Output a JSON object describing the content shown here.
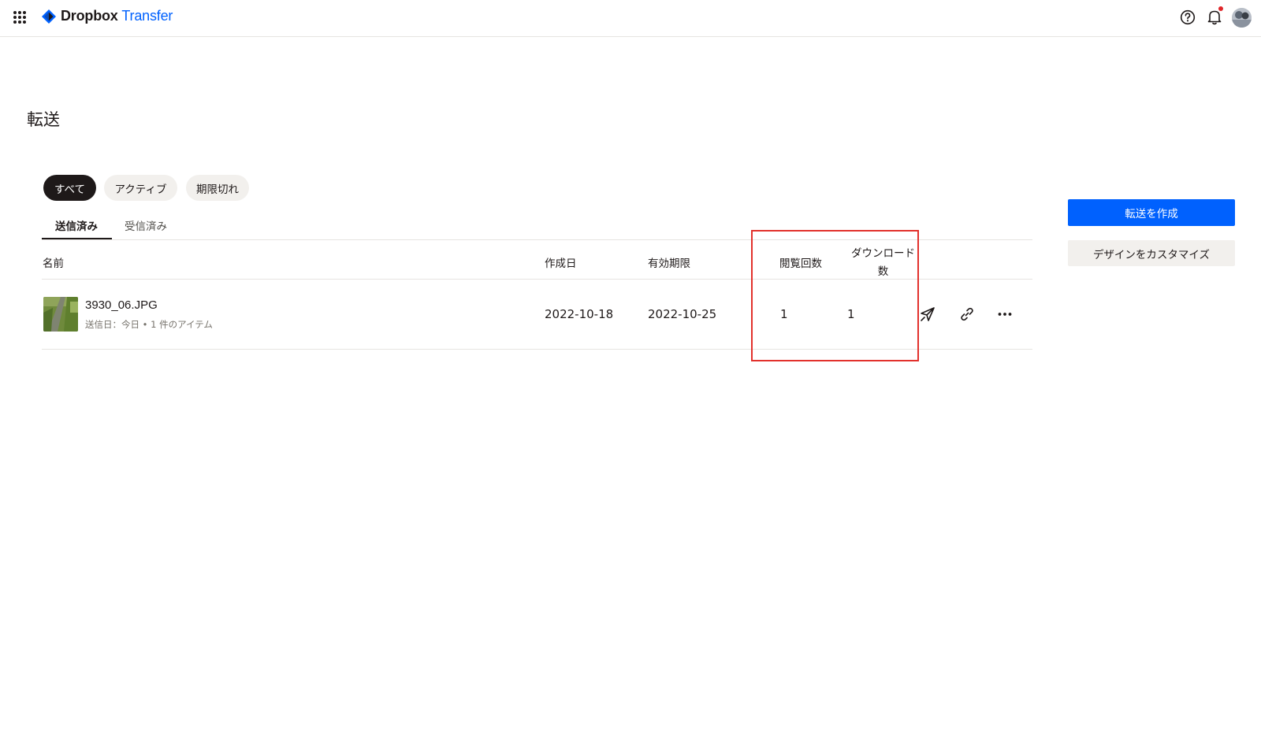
{
  "header": {
    "brand_name": "Dropbox",
    "product_name": "Transfer",
    "accent_color": "#0061fe",
    "icons": [
      "apps-grid-icon",
      "dropbox-logo-icon",
      "help-icon",
      "bell-icon",
      "avatar"
    ]
  },
  "page": {
    "title": "転送"
  },
  "filters": {
    "chips": [
      {
        "label": "すべて",
        "selected": true
      },
      {
        "label": "アクティブ",
        "selected": false
      },
      {
        "label": "期限切れ",
        "selected": false
      }
    ]
  },
  "tabs": [
    {
      "label": "送信済み",
      "selected": true
    },
    {
      "label": "受信済み",
      "selected": false
    }
  ],
  "table": {
    "columns": {
      "name": "名前",
      "created": "作成日",
      "expires": "有効期限",
      "views": "閲覧回数",
      "downloads_line1": "ダウンロード",
      "downloads_line2": "数"
    },
    "rows": [
      {
        "name": "3930_06.JPG",
        "meta": "送信日：今日 • 1 件のアイテム",
        "created": "2022-10-18",
        "expires": "2022-10-25",
        "views": "1",
        "downloads": "1",
        "actions": [
          "send-icon",
          "link-icon",
          "more-icon"
        ]
      }
    ]
  },
  "sidebar": {
    "create_button": "転送を作成",
    "customize_button": "デザインをカスタマイズ"
  },
  "annotation": {
    "highlight_color": "#e2312c"
  }
}
